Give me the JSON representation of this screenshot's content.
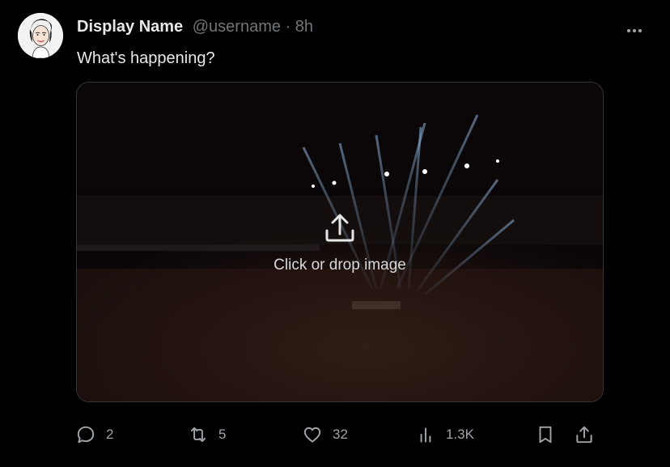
{
  "author": {
    "display_name": "Display Name",
    "handle": "@username",
    "separator": "·",
    "time": "8h"
  },
  "tweet": {
    "text": "What's happening?"
  },
  "media": {
    "upload_label": "Click or drop image",
    "icon": "upload-icon"
  },
  "actions": {
    "reply_count": "2",
    "retweet_count": "5",
    "like_count": "32",
    "views_count": "1.3K"
  },
  "icons": {
    "more": "more-icon",
    "reply": "reply-icon",
    "retweet": "retweet-icon",
    "like": "heart-icon",
    "views": "analytics-icon",
    "bookmark": "bookmark-icon",
    "share": "share-icon"
  },
  "colors": {
    "background": "#000000",
    "text_primary": "#e7e9ea",
    "text_secondary": "#71767b",
    "border": "#333639"
  }
}
